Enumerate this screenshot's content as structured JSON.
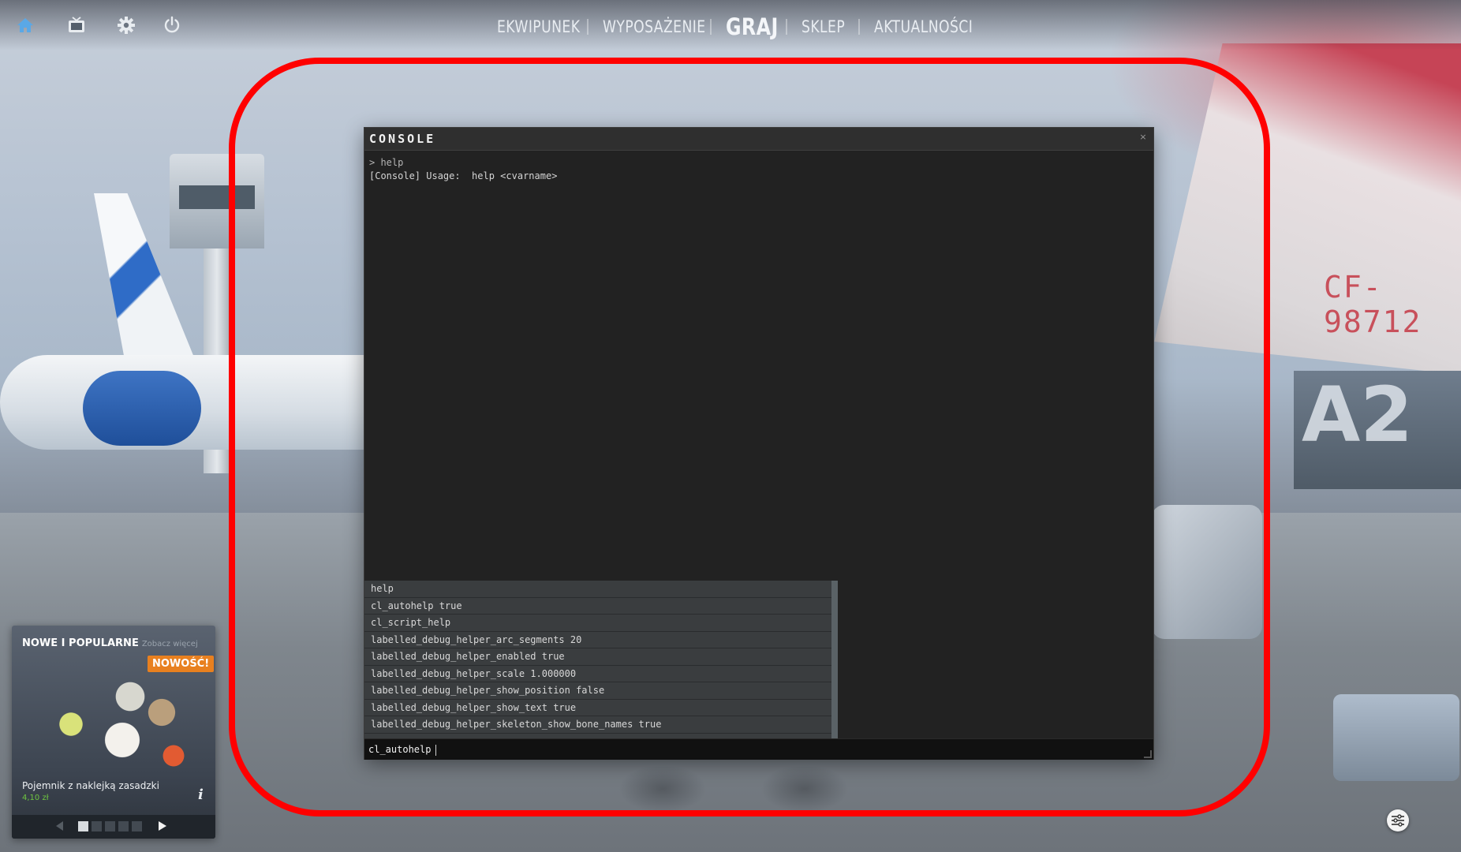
{
  "topbar": {
    "icons": [
      "home-icon",
      "tv-icon",
      "gear-icon",
      "power-icon"
    ],
    "nav": [
      {
        "label": "EKWIPUNEK",
        "active": false
      },
      {
        "label": "WYPOSAŻENIE",
        "active": false
      },
      {
        "label": "GRAJ",
        "active": true
      },
      {
        "label": "SKLEP",
        "active": false
      },
      {
        "label": "AKTUALNOŚCI",
        "active": false
      }
    ],
    "home_color": "#5aa8e6"
  },
  "scene": {
    "plane_registration": "CF-98712",
    "hangar_sign": "A2"
  },
  "console": {
    "title": "CONSOLE",
    "close_glyph": "×",
    "output": [
      {
        "text": "> help",
        "type": "echo"
      },
      {
        "text": "[Console] Usage:  help <cvarname>",
        "type": "line"
      }
    ],
    "suggestions": [
      "help",
      "cl_autohelp true",
      "cl_script_help",
      "labelled_debug_helper_arc_segments 20",
      "labelled_debug_helper_enabled true",
      "labelled_debug_helper_scale 1.000000",
      "labelled_debug_helper_show_position false",
      "labelled_debug_helper_show_text true",
      "labelled_debug_helper_skeleton_show_bone_names true"
    ],
    "input_value": "cl_autohelp"
  },
  "promo": {
    "header": "NOWE I POPULARNE",
    "header_more": "Zobacz więcej",
    "badge": "NOWOŚĆ!",
    "item_name": "Pojemnik z naklejką zasadzki",
    "price": "4,10 zł",
    "info_glyph": "i",
    "pager": {
      "pages": 5,
      "current": 1
    }
  },
  "annotation": {
    "color": "#ff0000"
  }
}
